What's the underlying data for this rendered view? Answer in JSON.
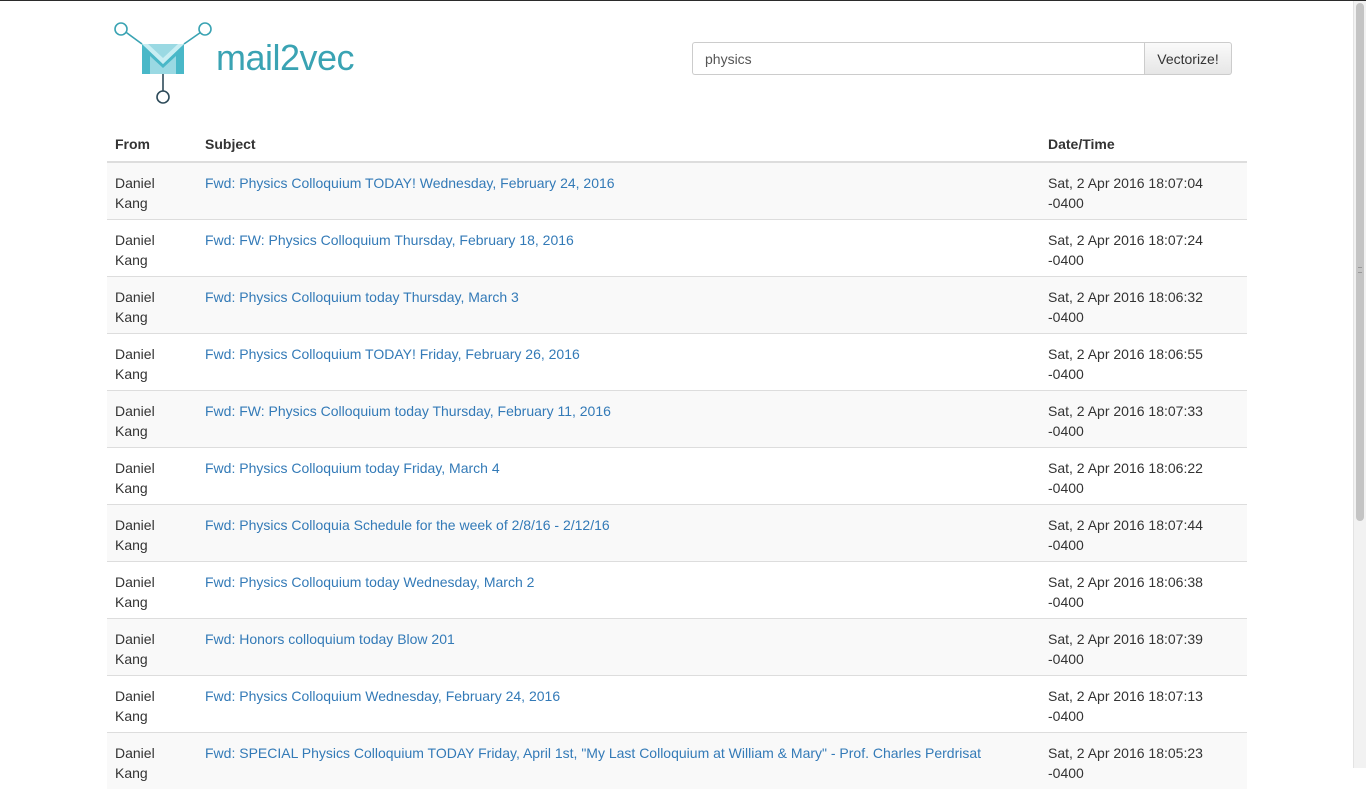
{
  "brand": {
    "name": "mail2vec",
    "accent_color": "#3aa3b3",
    "link_color": "#337ab7"
  },
  "search": {
    "value": "physics",
    "button_label": "Vectorize!"
  },
  "table": {
    "headers": {
      "from": "From",
      "subject": "Subject",
      "date": "Date/Time"
    },
    "rows": [
      {
        "from": "Daniel Kang",
        "subject": "Fwd: Physics Colloquium TODAY! Wednesday, February 24, 2016",
        "date": "Sat, 2 Apr 2016 18:07:04 -0400"
      },
      {
        "from": "Daniel Kang",
        "subject": "Fwd: FW: Physics Colloquium Thursday, February 18, 2016",
        "date": "Sat, 2 Apr 2016 18:07:24 -0400"
      },
      {
        "from": "Daniel Kang",
        "subject": "Fwd: Physics Colloquium today Thursday, March 3",
        "date": "Sat, 2 Apr 2016 18:06:32 -0400"
      },
      {
        "from": "Daniel Kang",
        "subject": "Fwd: Physics Colloquium TODAY! Friday, February 26, 2016",
        "date": "Sat, 2 Apr 2016 18:06:55 -0400"
      },
      {
        "from": "Daniel Kang",
        "subject": "Fwd: FW: Physics Colloquium today Thursday, February 11, 2016",
        "date": "Sat, 2 Apr 2016 18:07:33 -0400"
      },
      {
        "from": "Daniel Kang",
        "subject": "Fwd: Physics Colloquium today Friday, March 4",
        "date": "Sat, 2 Apr 2016 18:06:22 -0400"
      },
      {
        "from": "Daniel Kang",
        "subject": "Fwd: Physics Colloquia Schedule for the week of 2/8/16 - 2/12/16",
        "date": "Sat, 2 Apr 2016 18:07:44 -0400"
      },
      {
        "from": "Daniel Kang",
        "subject": "Fwd: Physics Colloquium today Wednesday, March 2",
        "date": "Sat, 2 Apr 2016 18:06:38 -0400"
      },
      {
        "from": "Daniel Kang",
        "subject": "Fwd: Honors colloquium today Blow 201",
        "date": "Sat, 2 Apr 2016 18:07:39 -0400"
      },
      {
        "from": "Daniel Kang",
        "subject": "Fwd: Physics Colloquium Wednesday, February 24, 2016",
        "date": "Sat, 2 Apr 2016 18:07:13 -0400"
      },
      {
        "from": "Daniel Kang",
        "subject": "Fwd: SPECIAL Physics Colloquium TODAY Friday, April 1st, \"My Last Colloquium at William & Mary\" - Prof. Charles Perdrisat",
        "date": "Sat, 2 Apr 2016 18:05:23 -0400"
      }
    ]
  }
}
